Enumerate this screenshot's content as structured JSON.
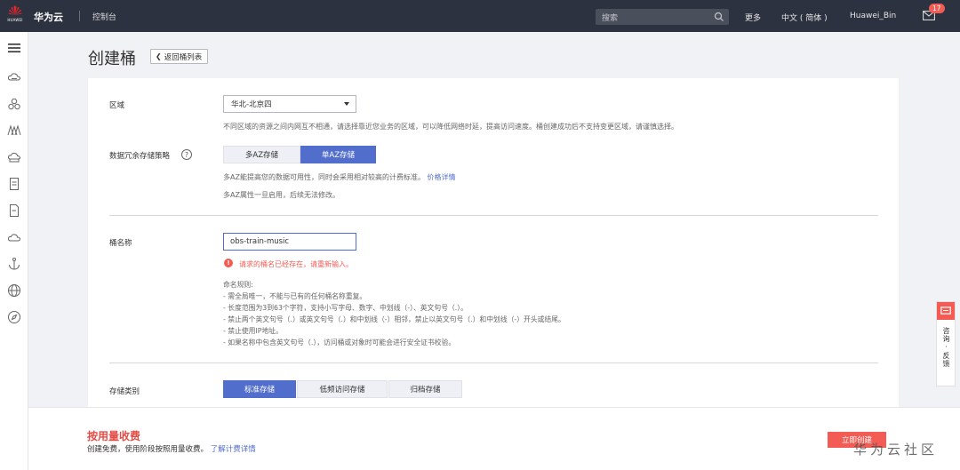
{
  "header": {
    "logo_text": "HUAWEI",
    "brand": "华为云",
    "console": "控制台",
    "search_placeholder": "搜索",
    "more": "更多",
    "language": "中文 ( 简体 )",
    "user": "Huawei_Bin",
    "mail_badge": "17"
  },
  "sidebar": {
    "icons": [
      "menu-icon",
      "cloud-server-icon",
      "cluster-icon",
      "bridge-icon",
      "storage-icon",
      "document-icon",
      "file-icon",
      "cloud-icon",
      "anchor-icon",
      "globe-icon",
      "compass-icon"
    ]
  },
  "page": {
    "title": "创建桶",
    "back_label": "返回桶列表"
  },
  "form": {
    "region_label": "区域",
    "region_value": "华北-北京四",
    "region_hint": "不同区域的资源之间内网互不相通，请选择靠近您业务的区域，可以降低网络时延，提高访问速度。桶创建成功后不支持变更区域，请谨慎选择。",
    "redundancy_label": "数据冗余存储策略",
    "redundancy_options": [
      "多AZ存储",
      "单AZ存储"
    ],
    "redundancy_selected": "单AZ存储",
    "redundancy_hint": "多AZ能提高您的数据可用性，同时会采用相对较高的计费标准。",
    "price_link": "价格详情",
    "redundancy_hint2": "多AZ属性一旦启用，后续无法修改。",
    "name_label": "桶名称",
    "name_value": "obs-train-music",
    "name_error": "请求的桶名已经存在，请重新输入。",
    "rules": [
      "命名规则:",
      "- 需全局唯一，不能与已有的任何桶名称重复。",
      "- 长度范围为3到63个字符，支持小写字母、数字、中划线（-）、英文句号（.）。",
      "- 禁止两个英文句号（.）或英文句号（.）和中划线（-）相邻，禁止以英文句号（.）和中划线（-）开头或结尾。",
      "- 禁止使用IP地址。",
      "- 如果名称中包含英文句号（.），访问桶或对象时可能会进行安全证书校验。"
    ],
    "storage_label": "存储类别",
    "storage_options": [
      "标准存储",
      "低频访问存储",
      "归档存储"
    ],
    "storage_selected": "标准存储"
  },
  "footer": {
    "billing_title": "按用量收费",
    "billing_sub": "创建免费，使用阶段按照用量收费。",
    "billing_link": "了解计费详情",
    "create_button": "立即创建"
  },
  "float": {
    "text": "咨询·反馈"
  },
  "watermark": "华为云社区",
  "colors": {
    "topbar": "#2d3240",
    "accent": "#526ecc",
    "error": "#f25c54"
  }
}
